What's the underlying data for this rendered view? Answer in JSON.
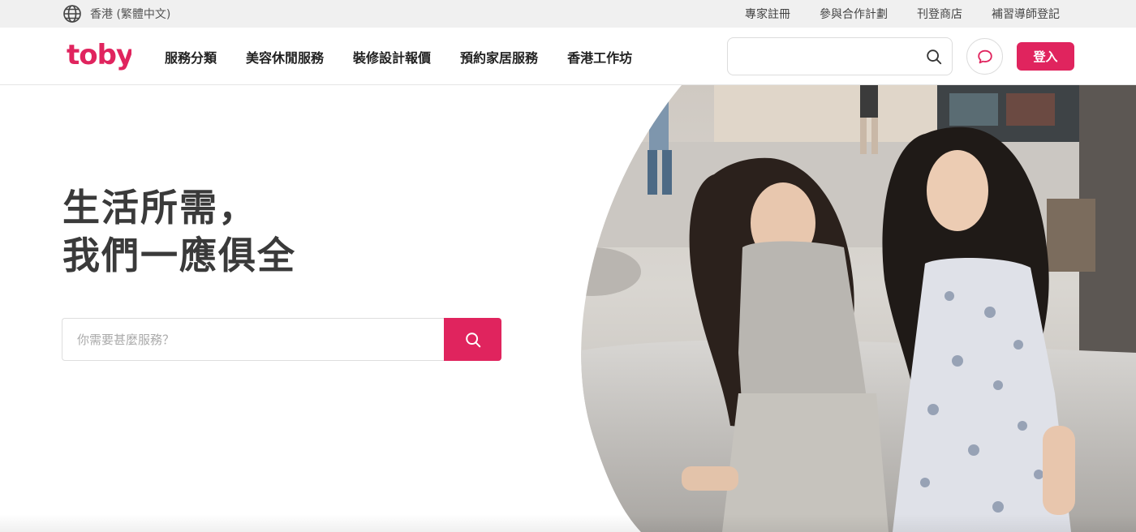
{
  "topbar": {
    "language": "香港 (繁體中文)",
    "links": [
      "專家註冊",
      "參與合作計劃",
      "刊登商店",
      "補習導師登記"
    ]
  },
  "header": {
    "logo_text": "toby",
    "nav": [
      "服務分類",
      "美容休閒服務",
      "裝修設計報價",
      "預約家居服務",
      "香港工作坊"
    ],
    "search_value": "",
    "login_label": "登入"
  },
  "hero": {
    "title_line1": "生活所需，",
    "title_line2": "我們一應俱全",
    "search_placeholder": "你需要甚麼服務？"
  },
  "icons": {
    "language": "globe-icon",
    "search": "search-icon",
    "chat": "chat-icon"
  },
  "colors": {
    "brand": "#e0245e",
    "topbar_bg": "#f0f0f0"
  }
}
